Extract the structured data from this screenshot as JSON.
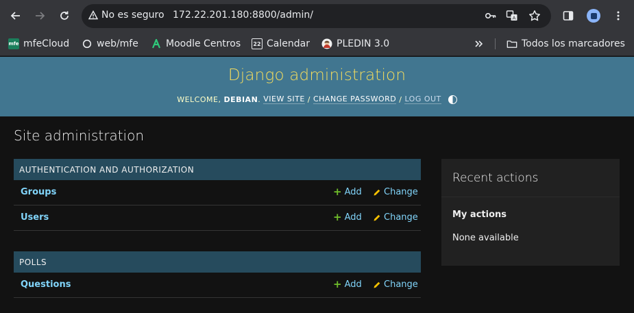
{
  "browser": {
    "security_label": "No es seguro",
    "url": "172.22.201.180:8800/admin/"
  },
  "bookmarks": {
    "items": [
      {
        "label": "mfeCloud",
        "icon": "mfe-logo-icon"
      },
      {
        "label": "web/mfe",
        "icon": "globe-icon"
      },
      {
        "label": "Moodle Centros",
        "icon": "moodle-icon"
      },
      {
        "label": "Calendar",
        "icon": "calendar-icon"
      },
      {
        "label": "PLEDIN 3.0",
        "icon": "pledin-icon"
      }
    ],
    "all_bookmarks_label": "Todos los marcadores",
    "mfe_icon_text": "mfe",
    "calendar_icon_text": "22"
  },
  "header": {
    "site_title": "Django administration",
    "welcome": "WELCOME,",
    "username": "DEBIAN",
    "view_site": "VIEW SITE",
    "change_password": "CHANGE PASSWORD",
    "log_out": "LOG OUT",
    "separator": " / "
  },
  "content": {
    "title": "Site administration",
    "modules": [
      {
        "caption": "AUTHENTICATION AND AUTHORIZATION",
        "rows": [
          {
            "name": "Groups",
            "add": "Add",
            "change": "Change"
          },
          {
            "name": "Users",
            "add": "Add",
            "change": "Change"
          }
        ]
      },
      {
        "caption": "POLLS",
        "rows": [
          {
            "name": "Questions",
            "add": "Add",
            "change": "Change"
          }
        ]
      }
    ]
  },
  "recent_actions": {
    "title": "Recent actions",
    "subtitle": "My actions",
    "empty": "None available"
  },
  "colors": {
    "header_bg": "#417690",
    "title_yellow": "#f5dd5d",
    "caption_bg": "#264b5d",
    "link": "#81d4fa",
    "add_green": "#70bf2b",
    "change_yellow": "#f5c000"
  }
}
